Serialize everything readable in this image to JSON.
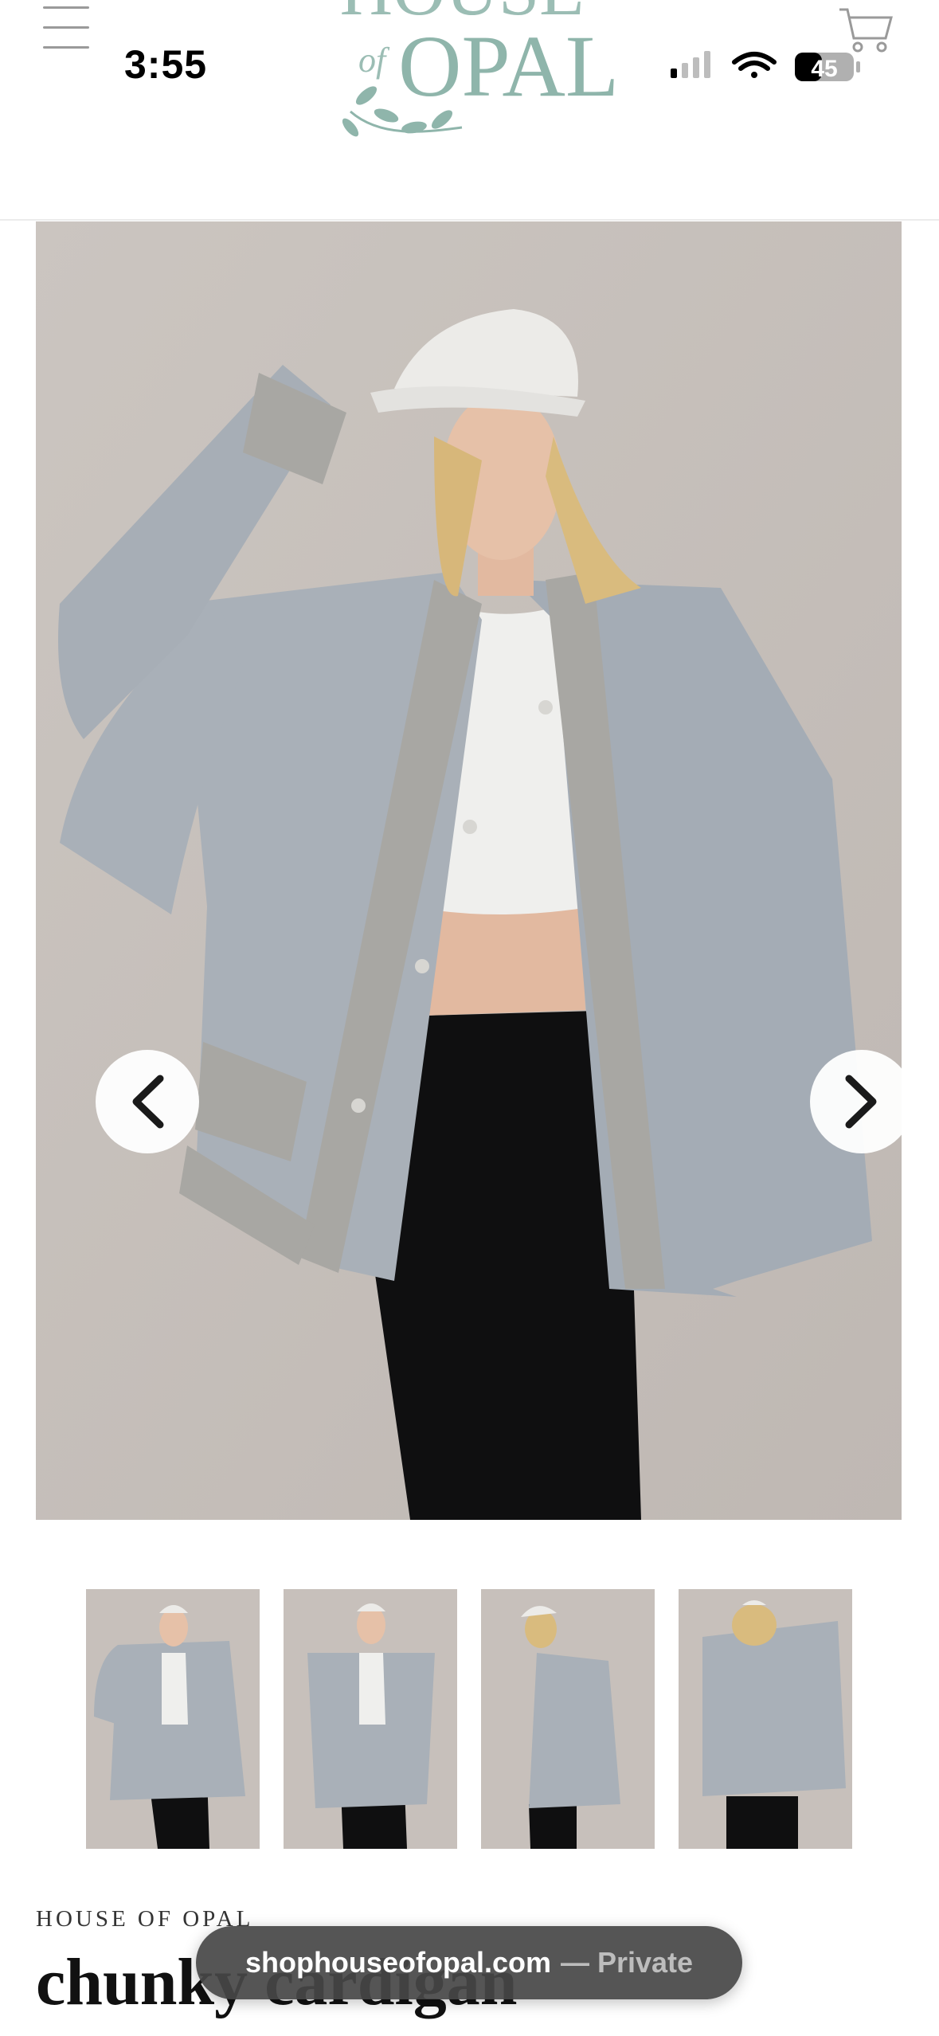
{
  "status_bar": {
    "time": "3:55",
    "battery": "45",
    "icons": [
      "cellular-signal-icon",
      "wifi-icon",
      "battery-icon"
    ]
  },
  "header": {
    "logo_text_top": "HOUSE",
    "logo_text_of": "of",
    "logo_text_main": "OPAL",
    "icons": [
      "hamburger-menu-icon",
      "shopping-cart-icon"
    ]
  },
  "gallery": {
    "prev_icon": "chevron-left-icon",
    "next_icon": "chevron-right-icon",
    "thumbnail_count": 4
  },
  "product": {
    "brand": "HOUSE OF OPAL",
    "title": "chunky cardigan"
  },
  "browser": {
    "url": "shophouseofopal.com",
    "mode": "— Private"
  },
  "colors": {
    "logo": "#8fb5ab",
    "backdrop": "#c9c3bf",
    "cardigan": "#a9b0b8",
    "rib": "#a8a7a3"
  }
}
